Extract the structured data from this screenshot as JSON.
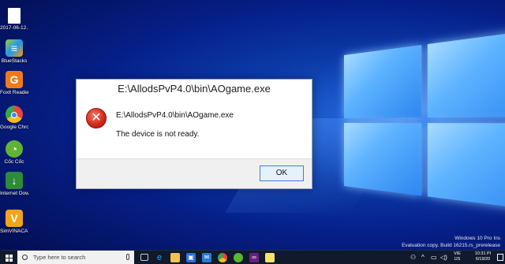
{
  "desktop": {
    "icons": [
      {
        "label": "2017-06-12...",
        "icon": "document-icon",
        "color": "#ffffff"
      },
      {
        "label": "BlueStacks",
        "icon": "bluestacks-icon",
        "color": "#4caf50"
      },
      {
        "label": "Foxit Reader",
        "icon": "foxit-icon",
        "color": "#f07a1a"
      },
      {
        "label": "Google Chrome",
        "icon": "chrome-icon",
        "color": "#e8453c"
      },
      {
        "label": "Cốc Cốc",
        "icon": "coccoc-icon",
        "color": "#5fb533"
      },
      {
        "label": "Internet Downloa...",
        "icon": "idm-icon",
        "color": "#2e8b3a"
      },
      {
        "label": "SimVINACA... - Shortcut",
        "icon": "simvinaca-icon",
        "color": "#f0a51a"
      }
    ]
  },
  "dialog": {
    "title": "E:\\AllodsPvP4.0\\bin\\AOgame.exe",
    "path": "E:\\AllodsPvP4.0\\bin\\AOgame.exe",
    "message": "The device is not ready.",
    "ok_label": "OK"
  },
  "watermark": {
    "line1": "Windows 10 Pro Ins",
    "line2": "Evaluation copy. Build 16215.rs_prerelease"
  },
  "taskbar": {
    "search_placeholder": "Type here to search",
    "apps": [
      "task-view-icon",
      "edge-icon",
      "file-explorer-icon",
      "store-icon",
      "mail-icon",
      "chrome-icon",
      "coccoc-icon",
      "visual-studio-icon",
      "sticky-notes-icon"
    ],
    "lang_top": "VIE",
    "lang_bottom": "US",
    "time": "10:31 PI",
    "date": "6/19/20"
  }
}
